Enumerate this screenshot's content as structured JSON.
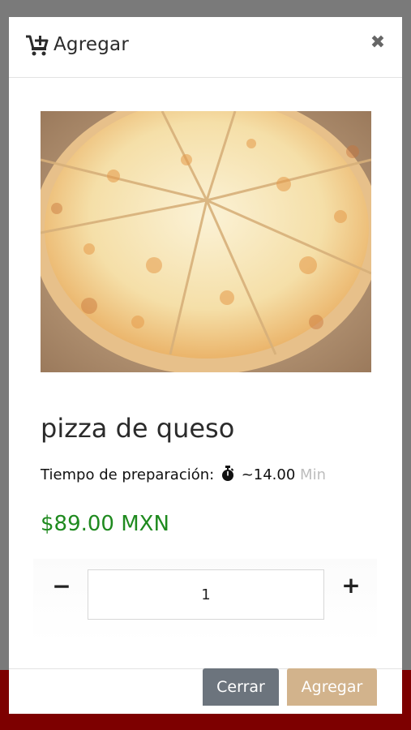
{
  "modal": {
    "title": "Agregar",
    "close_symbol": "✖",
    "icons": {
      "header": "cart-plus-icon",
      "close": "close-icon",
      "timer": "stopwatch-icon"
    }
  },
  "product": {
    "name": "pizza de queso",
    "prep_label": "Tiempo de preparación:",
    "prep_value": "~14.00",
    "prep_unit": "Min",
    "price": "$89.00 MXN",
    "image_alt": "cheese pizza"
  },
  "quantity": {
    "minus": "−",
    "plus": "+",
    "value": "1"
  },
  "footer": {
    "close_label": "Cerrar",
    "add_label": "Agregar"
  },
  "colors": {
    "price": "#1f8a1f",
    "close_button": "#6c747d",
    "add_button": "#d2b38c",
    "backdrop_accent": "#7d0000"
  }
}
